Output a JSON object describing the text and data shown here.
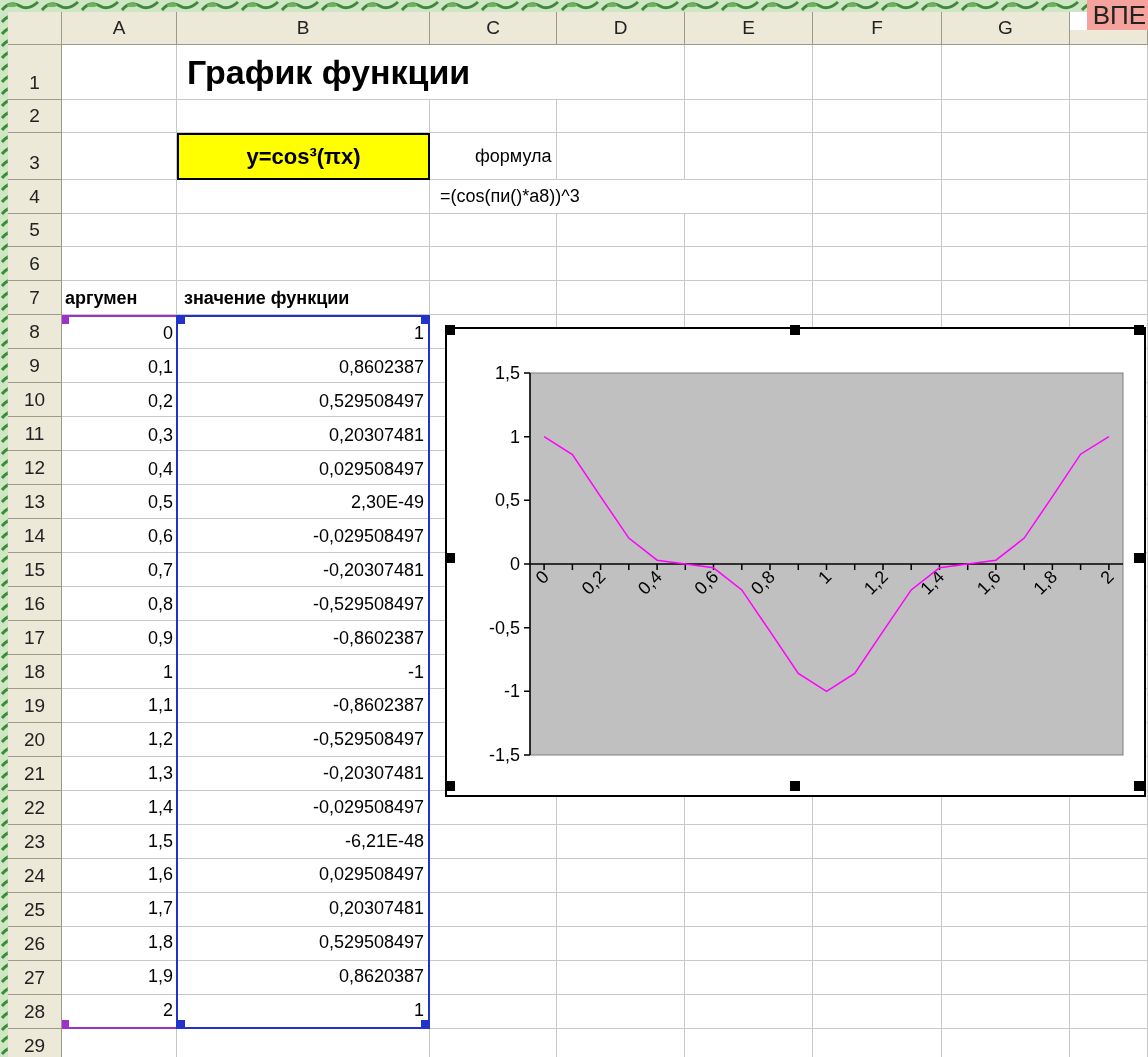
{
  "badge": "ВПЕ",
  "column_headers": [
    "A",
    "B",
    "C",
    "D",
    "E",
    "F",
    "G"
  ],
  "row_numbers": [
    "1",
    "2",
    "3",
    "4",
    "5",
    "6",
    "7",
    "8",
    "9",
    "10",
    "11",
    "12",
    "13",
    "14",
    "15",
    "16",
    "17",
    "18",
    "19",
    "20",
    "21",
    "22",
    "23",
    "24",
    "25",
    "26",
    "27",
    "28",
    "29"
  ],
  "title": "График функции",
  "function_label": "y=cos³(πx)",
  "formula_label": "формула",
  "formula": "=(cos(пи()*a8))^3",
  "table": {
    "headers": [
      "аргумен",
      "значение функции"
    ],
    "rows": [
      [
        "0",
        "1"
      ],
      [
        "0,1",
        "0,8602387"
      ],
      [
        "0,2",
        "0,529508497"
      ],
      [
        "0,3",
        "0,20307481"
      ],
      [
        "0,4",
        "0,029508497"
      ],
      [
        "0,5",
        "2,30E-49"
      ],
      [
        "0,6",
        "-0,029508497"
      ],
      [
        "0,7",
        "-0,20307481"
      ],
      [
        "0,8",
        "-0,529508497"
      ],
      [
        "0,9",
        "-0,8602387"
      ],
      [
        "1",
        "-1"
      ],
      [
        "1,1",
        "-0,8602387"
      ],
      [
        "1,2",
        "-0,529508497"
      ],
      [
        "1,3",
        "-0,20307481"
      ],
      [
        "1,4",
        "-0,029508497"
      ],
      [
        "1,5",
        "-6,21E-48"
      ],
      [
        "1,6",
        "0,029508497"
      ],
      [
        "1,7",
        "0,20307481"
      ],
      [
        "1,8",
        "0,529508497"
      ],
      [
        "1,9",
        "0,8620387"
      ],
      [
        "2",
        "1"
      ]
    ]
  },
  "chart": {
    "selected": true,
    "chart_data": {
      "type": "line",
      "x": [
        0,
        0.1,
        0.2,
        0.3,
        0.4,
        0.5,
        0.6,
        0.7,
        0.8,
        0.9,
        1,
        1.1,
        1.2,
        1.3,
        1.4,
        1.5,
        1.6,
        1.7,
        1.8,
        1.9,
        2
      ],
      "series": [
        {
          "color": "#ff00ff",
          "values": [
            1,
            0.8602387,
            0.529508497,
            0.20307481,
            0.029508497,
            0,
            -0.029508497,
            -0.20307481,
            -0.529508497,
            -0.8602387,
            -1,
            -0.8602387,
            -0.529508497,
            -0.20307481,
            -0.029508497,
            0,
            0.029508497,
            0.20307481,
            0.529508497,
            0.8620387,
            1
          ]
        }
      ],
      "xlim": [
        -0.05,
        2.05
      ],
      "ylim": [
        -1.5,
        1.5
      ],
      "yticks": [
        {
          "value": 1.5,
          "label": "1,5"
        },
        {
          "value": 1,
          "label": "1"
        },
        {
          "value": 0.5,
          "label": "0,5"
        },
        {
          "value": 0,
          "label": "0"
        },
        {
          "value": -0.5,
          "label": "-0,5"
        },
        {
          "value": -1,
          "label": "-1"
        },
        {
          "value": -1.5,
          "label": "-1,5"
        }
      ],
      "xticks": [
        {
          "value": 0,
          "label": "0"
        },
        {
          "value": 0.2,
          "label": "0,2"
        },
        {
          "value": 0.4,
          "label": "0,4"
        },
        {
          "value": 0.6,
          "label": "0,6"
        },
        {
          "value": 0.8,
          "label": "0,8"
        },
        {
          "value": 1,
          "label": "1"
        },
        {
          "value": 1.2,
          "label": "1,2"
        },
        {
          "value": 1.4,
          "label": "1,4"
        },
        {
          "value": 1.6,
          "label": "1,6"
        },
        {
          "value": 1.8,
          "label": "1,8"
        },
        {
          "value": 2,
          "label": "2"
        }
      ]
    }
  }
}
